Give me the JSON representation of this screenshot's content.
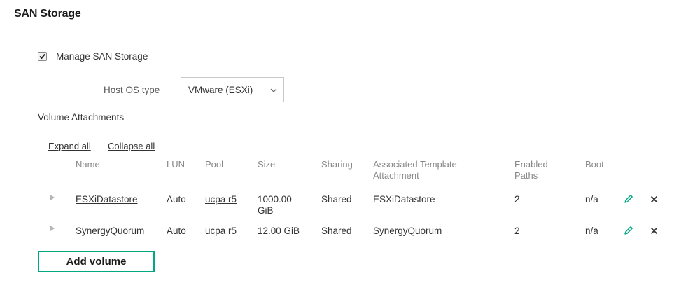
{
  "page": {
    "title": "SAN Storage"
  },
  "manage": {
    "label": "Manage SAN Storage",
    "checked": true
  },
  "host_os": {
    "label": "Host OS type",
    "value": "VMware (ESXi)"
  },
  "attachments": {
    "title": "Volume Attachments",
    "expand_all": "Expand all",
    "collapse_all": "Collapse all",
    "columns": [
      "Name",
      "LUN",
      "Pool",
      "Size",
      "Sharing",
      "Associated Template Attachment",
      "Enabled Paths",
      "Boot"
    ],
    "rows": [
      {
        "name": "ESXiDatastore",
        "lun": "Auto",
        "pool": "ucpa r5",
        "size": "1000.00 GiB",
        "sharing": "Shared",
        "template": "ESXiDatastore",
        "paths": "2",
        "boot": "n/a"
      },
      {
        "name": "SynergyQuorum",
        "lun": "Auto",
        "pool": "ucpa r5",
        "size": "12.00 GiB",
        "sharing": "Shared",
        "template": "SynergyQuorum",
        "paths": "2",
        "boot": "n/a"
      }
    ]
  },
  "add_volume": {
    "label": "Add volume"
  },
  "colors": {
    "accent": "#01a982",
    "text": "#333333",
    "muted": "#888888"
  },
  "icons": {
    "edit": "pencil-icon",
    "delete": "close-icon",
    "expand": "triangle-right-icon",
    "dropdown": "chevron-down-icon"
  }
}
